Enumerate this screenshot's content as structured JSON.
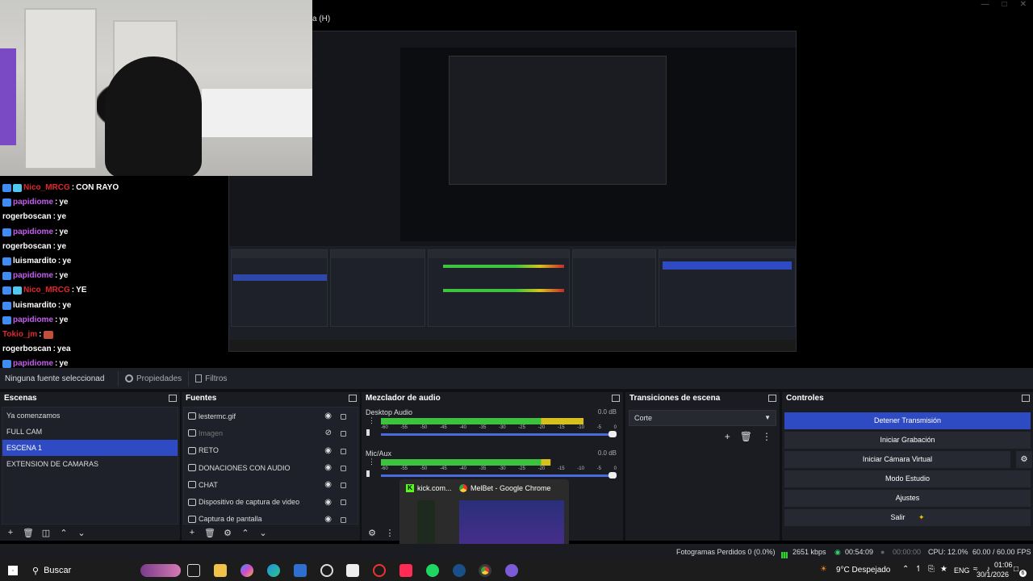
{
  "obs_title_suffix": "a (H)",
  "chat": [
    {
      "user": "Nico_MRCG",
      "msg": "CON RAYO",
      "color": "#e2262f",
      "badges": 2
    },
    {
      "user": "papidiome",
      "msg": "ye",
      "color": "#c75cf0",
      "badges": 1
    },
    {
      "user": "rogerboscan",
      "msg": "ye",
      "color": "#ffffff",
      "badges": 0
    },
    {
      "user": "papidiome",
      "msg": "ye",
      "color": "#c75cf0",
      "badges": 1
    },
    {
      "user": "rogerboscan",
      "msg": "ye",
      "color": "#ffffff",
      "badges": 0
    },
    {
      "user": "luismardito",
      "msg": "ye",
      "color": "#ffffff",
      "badges": 1
    },
    {
      "user": "papidiome",
      "msg": "ye",
      "color": "#c75cf0",
      "badges": 1
    },
    {
      "user": "Nico_MRCG",
      "msg": "YE",
      "color": "#e2262f",
      "badges": 2
    },
    {
      "user": "luismardito",
      "msg": "ye",
      "color": "#ffffff",
      "badges": 1
    },
    {
      "user": "papidiome",
      "msg": "ye",
      "color": "#c75cf0",
      "badges": 1
    },
    {
      "user": "Tokio_jm",
      "msg": "",
      "color": "#e2262f",
      "badges": 0,
      "emote": true
    },
    {
      "user": "rogerboscan",
      "msg": "yea",
      "color": "#ffffff",
      "badges": 0
    },
    {
      "user": "papidiome",
      "msg": "ye",
      "color": "#c75cf0",
      "badges": 1
    }
  ],
  "source_bar": {
    "no_source": "Ninguna fuente seleccionad",
    "properties": "Propiedades",
    "filters": "Filtros"
  },
  "scenes": {
    "title": "Escenas",
    "items": [
      "Ya comenzamos",
      "FULL CAM",
      "ESCENA 1",
      "EXTENSION DE CAMARAS"
    ],
    "active_index": 2
  },
  "sources": {
    "title": "Fuentes",
    "items": [
      {
        "name": "lestermc.gif",
        "icon": "image-icon",
        "visible": true
      },
      {
        "name": "Imagen",
        "icon": "image-icon",
        "visible": false
      },
      {
        "name": "RETO",
        "icon": "browser-icon",
        "visible": true
      },
      {
        "name": "DONACIONES CON AUDIO",
        "icon": "browser-icon",
        "visible": true
      },
      {
        "name": "CHAT",
        "icon": "browser-icon",
        "visible": true
      },
      {
        "name": "Dispositivo de captura de video",
        "icon": "camera-icon",
        "visible": true
      },
      {
        "name": "Captura de pantalla",
        "icon": "monitor-icon",
        "visible": true
      }
    ]
  },
  "mixer": {
    "title": "Mezclador de audio",
    "channels": [
      {
        "name": "Desktop Audio",
        "db": "0.0 dB",
        "level": 0.86
      },
      {
        "name": "Mic/Aux",
        "db": "0.0 dB",
        "level": 0.72
      }
    ],
    "scale": [
      "-60",
      "-55",
      "-50",
      "-45",
      "-40",
      "-35",
      "-30",
      "-25",
      "-20",
      "-15",
      "-10",
      "-5",
      "0"
    ]
  },
  "transitions": {
    "title": "Transiciones de escena",
    "selected": "Corte"
  },
  "controls": {
    "title": "Controles",
    "stop_stream": "Detener Transmisión",
    "start_recording": "Iniciar Grabación",
    "virtual_cam": "Iniciar Cámara Virtual",
    "studio_mode": "Modo Estudio",
    "settings": "Ajustes",
    "exit": "Salir"
  },
  "thumbnail_popup": {
    "tab1": "kick.com...",
    "tab2": "MelBet - Google Chrome"
  },
  "status": {
    "dropped": "Fotogramas Perdidos 0 (0.0%)",
    "kbps": "2651 kbps",
    "stream_time": "00:54:09",
    "rec_time": "00:00:00",
    "cpu": "CPU: 12.0%",
    "fps": "60.00 / 60.00 FPS"
  },
  "taskbar": {
    "search": "Buscar",
    "weather": "9°C  Despejado",
    "lang": "ENG",
    "time": "01:06",
    "date": "30/1/2026",
    "notifications": "6"
  },
  "colors": {
    "accent": "#2f4bc4",
    "panel": "#1a1c22",
    "meter_green": "#3cc23c",
    "meter_yellow": "#d6c01e",
    "meter_red": "#c82a34"
  }
}
